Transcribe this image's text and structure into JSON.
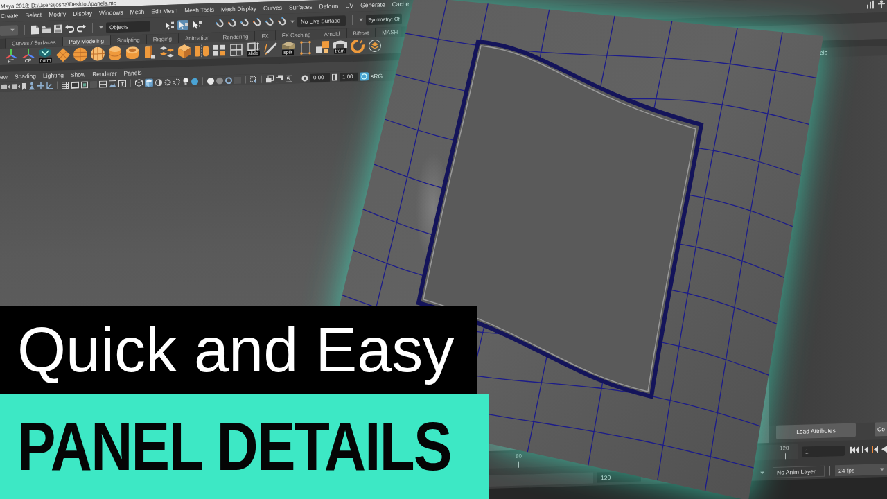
{
  "window": {
    "title": "Maya 2018: D:\\Users\\josha\\Desktop\\panels.mb"
  },
  "menu_bar": [
    "Create",
    "Select",
    "Modify",
    "Display",
    "Windows",
    "Mesh",
    "Edit Mesh",
    "Mesh Tools",
    "Mesh Display",
    "Curves",
    "Surfaces",
    "Deform",
    "UV",
    "Generate",
    "Cache"
  ],
  "status_line": {
    "object_mode": "Objects",
    "select_tools": [
      {
        "selected": false
      },
      {
        "selected": true
      },
      {
        "selected": false
      }
    ],
    "live_surface": "No Live Surface",
    "symmetry": "Symmetry: Of"
  },
  "shelf": {
    "tabs": [
      {
        "label": "Curves / Surfaces",
        "selected": false
      },
      {
        "label": "Poly Modeling",
        "selected": true
      },
      {
        "label": "Sculpting",
        "selected": false
      },
      {
        "label": "Rigging",
        "selected": false
      },
      {
        "label": "Animation",
        "selected": false
      },
      {
        "label": "Rendering",
        "selected": false
      },
      {
        "label": "FX",
        "selected": false
      },
      {
        "label": "FX Caching",
        "selected": false
      },
      {
        "label": "Arnold",
        "selected": false
      },
      {
        "label": "Bifrost",
        "selected": false
      },
      {
        "label": "MASH",
        "selected": false
      }
    ],
    "icon_labels": [
      "FT",
      "CP",
      "norm",
      "slide",
      "split",
      "tram"
    ]
  },
  "viewport": {
    "menu": [
      "ew",
      "Shading",
      "Lighting",
      "Show",
      "Renderer",
      "Panels"
    ],
    "shading_modes": [
      {
        "selected": false
      },
      {
        "selected": true
      }
    ],
    "exposure": "0.00",
    "gamma": "1.00",
    "color_management": {
      "on": true,
      "label": "sRG"
    }
  },
  "attribute_editor": {
    "menu": [
      "elp"
    ],
    "buttons": [
      "Load Attributes",
      "Co"
    ]
  },
  "time_slider": {
    "ruler_labels": [
      "80",
      "120"
    ],
    "current_frame": "1"
  },
  "range_slider": {
    "end_time": "120",
    "anim_layer": "No Anim Layer",
    "frame_rate": "24 fps"
  },
  "headline": {
    "line_1": "Quick and Easy",
    "line_2": "PANEL DETAILS"
  }
}
